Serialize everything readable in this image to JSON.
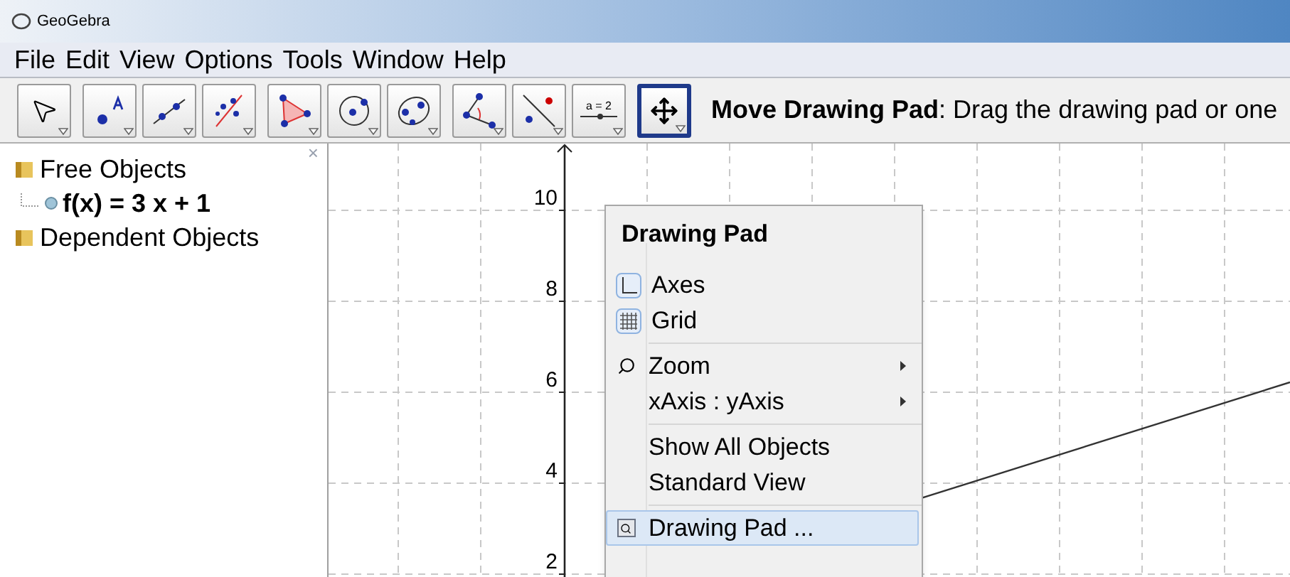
{
  "window": {
    "title": "GeoGebra"
  },
  "menu": [
    "File",
    "Edit",
    "View",
    "Options",
    "Tools",
    "Window",
    "Help"
  ],
  "toolbar": {
    "groups": [
      [
        {
          "kind": "pointer",
          "selected": false
        }
      ],
      [
        {
          "kind": "point",
          "selected": false
        },
        {
          "kind": "line",
          "selected": false
        },
        {
          "kind": "perpendicular",
          "selected": false
        }
      ],
      [
        {
          "kind": "polygon",
          "selected": false
        },
        {
          "kind": "circle",
          "selected": false
        },
        {
          "kind": "conic",
          "selected": false
        }
      ],
      [
        {
          "kind": "angle",
          "selected": false
        },
        {
          "kind": "reflect",
          "selected": false
        },
        {
          "kind": "slider",
          "selected": false,
          "label": "a = 2"
        }
      ],
      [
        {
          "kind": "move",
          "selected": true
        }
      ]
    ],
    "help": "**Move Drawing Pad**: Drag the drawing pad or one"
  },
  "algebra": {
    "close": "×",
    "tree": [
      {
        "label": "Free Objects",
        "children": [
          {
            "label": "f(x) = 3 x + 1"
          }
        ]
      },
      {
        "label": "Dependent Objects"
      }
    ]
  },
  "drawing_pad": {
    "y_labels": [
      "10",
      "8",
      "6",
      "4",
      "2"
    ]
  },
  "context_menu": {
    "title": "Drawing Pad",
    "sections": [
      [
        {
          "label": "Axes",
          "kind": "axes",
          "checked": true,
          "selected": false
        },
        {
          "label": "Grid",
          "kind": "grid",
          "checked": true,
          "selected": false
        }
      ],
      [
        {
          "label": "Zoom",
          "kind": "zoom",
          "submenu": true,
          "selected": false
        },
        {
          "label": "xAxis : yAxis",
          "kind": "plain",
          "submenu": true,
          "selected": false
        }
      ],
      [
        {
          "label": "Show All Objects",
          "kind": "plain",
          "selected": false
        },
        {
          "label": "Standard View",
          "kind": "plain",
          "selected": false
        }
      ],
      [
        {
          "label": "Drawing Pad ...",
          "kind": "pad",
          "selected": true
        }
      ]
    ]
  }
}
